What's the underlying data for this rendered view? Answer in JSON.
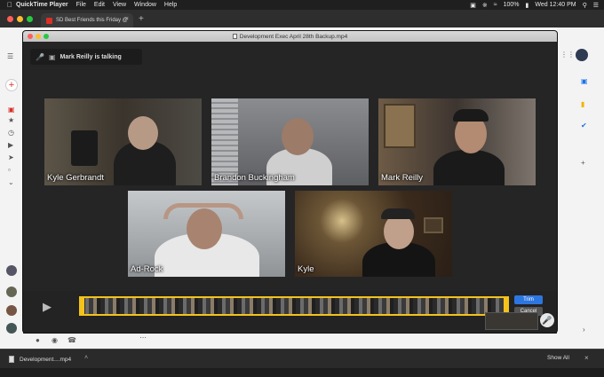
{
  "menubar": {
    "app": "QuickTime Player",
    "items": [
      "File",
      "Edit",
      "View",
      "Window",
      "Help"
    ],
    "battery": "100%",
    "clock": "Wed 12:40 PM"
  },
  "browser": {
    "tab_title": "SD Best Friends this Friday @"
  },
  "qt": {
    "title": "Development Exec April 28th Backup.mp4",
    "talking": "Mark Reilly is talking",
    "participants": [
      {
        "name": "Kyle Gerbrandt"
      },
      {
        "name": "Brandon Buckingham"
      },
      {
        "name": "Mark Reilly"
      },
      {
        "name": "Ad-Rock"
      },
      {
        "name": "Kyle"
      }
    ],
    "trim_label": "Trim",
    "cancel_label": "Cancel"
  },
  "downloads": {
    "file": "Development....mp4",
    "show_all": "Show All"
  },
  "colors": {
    "accent": "#f3c21b",
    "trim_blue": "#2d76e0"
  }
}
